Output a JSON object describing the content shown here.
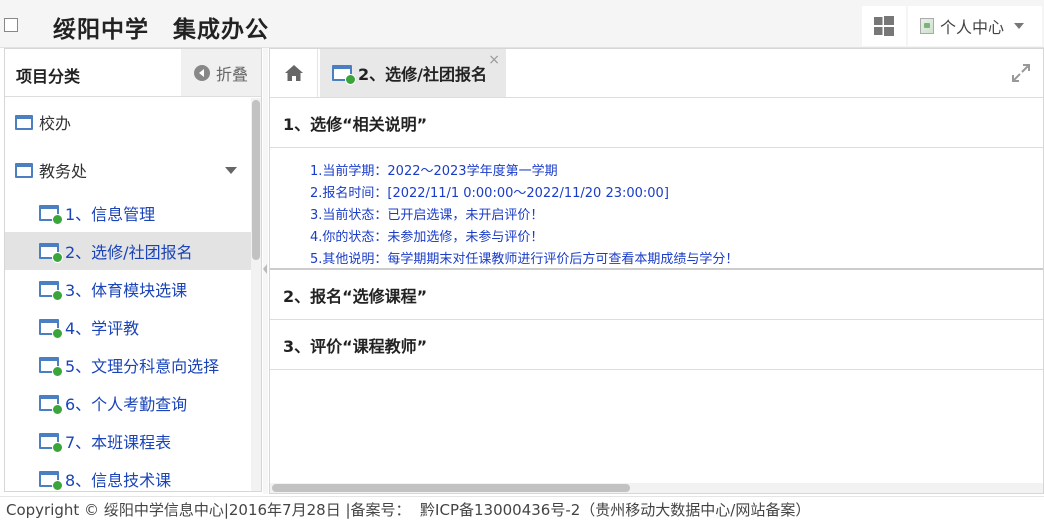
{
  "header": {
    "title": "绥阳中学　集成办公",
    "user_menu_label": "个人中心"
  },
  "sidebar": {
    "title": "项目分类",
    "collapse_label": "折叠",
    "groups": [
      {
        "label": "校办"
      },
      {
        "label": "教务处"
      }
    ],
    "items": [
      {
        "label": "1、信息管理"
      },
      {
        "label": "2、选修/社团报名"
      },
      {
        "label": "3、体育模块选课"
      },
      {
        "label": "4、学评教"
      },
      {
        "label": "5、文理分科意向选择"
      },
      {
        "label": "6、个人考勤查询"
      },
      {
        "label": "7、本班课程表"
      },
      {
        "label": "8、信息技术课"
      }
    ],
    "active_item_index": 1
  },
  "tabs": {
    "active_tab_label": "2、选修/社团报名",
    "close_symbol": "×"
  },
  "panels": [
    {
      "header": "1、选修“相关说明”",
      "lines": [
        "1.当前学期：2022～2023学年度第一学期",
        "2.报名时间：[2022/11/1 0:00:00～2022/11/20 23:00:00]",
        "3.当前状态：已开启选课，未开启评价！",
        "4.你的状态：未参加选修，未参与评价！",
        "5.其他说明：每学期期末对任课教师进行评价后方可查看本期成绩与学分！"
      ]
    },
    {
      "header": "2、报名“选修课程”"
    },
    {
      "header": "3、评价“课程教师”"
    }
  ],
  "footer": {
    "text": "Copyright © 绥阳中学信息中心|2016年7月28日 |备案号：  黔ICP备13000436号-2（贵州移动大数据中心/网站备案）"
  },
  "colors": {
    "link_blue": "#1a44b8",
    "info_blue": "#1a3cc8",
    "icon_blue": "#4a7fc1",
    "badge_green": "#3aa53a",
    "active_bg": "#e3e3e3"
  },
  "icons": [
    "windows-icon",
    "broken-image-icon",
    "chevron-down-icon",
    "collapse-arrow-icon",
    "window-icon",
    "page-add-icon",
    "home-icon",
    "close-icon",
    "expand-icon"
  ]
}
